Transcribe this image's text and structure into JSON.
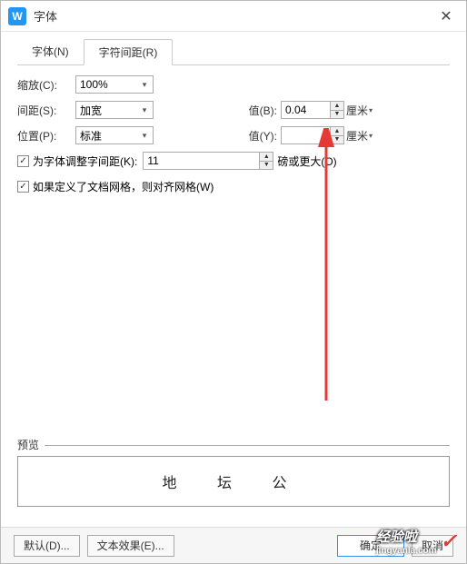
{
  "window": {
    "title": "字体",
    "app_icon_letter": "W"
  },
  "tabs": {
    "font": "字体(N)",
    "spacing": "字符间距(R)"
  },
  "scale": {
    "label": "缩放(C):",
    "value": "100%"
  },
  "spacing": {
    "label": "间距(S):",
    "value": "加宽",
    "value_b_label": "值(B):",
    "value_b": "0.04",
    "unit_b": "厘米"
  },
  "position": {
    "label": "位置(P):",
    "value": "标准",
    "value_y_label": "值(Y):",
    "value_y": "",
    "unit_y": "厘米"
  },
  "kerning": {
    "label": "为字体调整字间距(K):",
    "value": "11",
    "unit": "磅或更大(O)"
  },
  "snap": {
    "label": "如果定义了文档网格，则对齐网格(W)"
  },
  "preview": {
    "label": "预览",
    "text": "地 坛 公"
  },
  "buttons": {
    "default": "默认(D)...",
    "text_effect": "文本效果(E)...",
    "ok": "确定",
    "cancel": "取消"
  },
  "watermark": {
    "text": "经验啦",
    "url": "jingyanla.com"
  }
}
